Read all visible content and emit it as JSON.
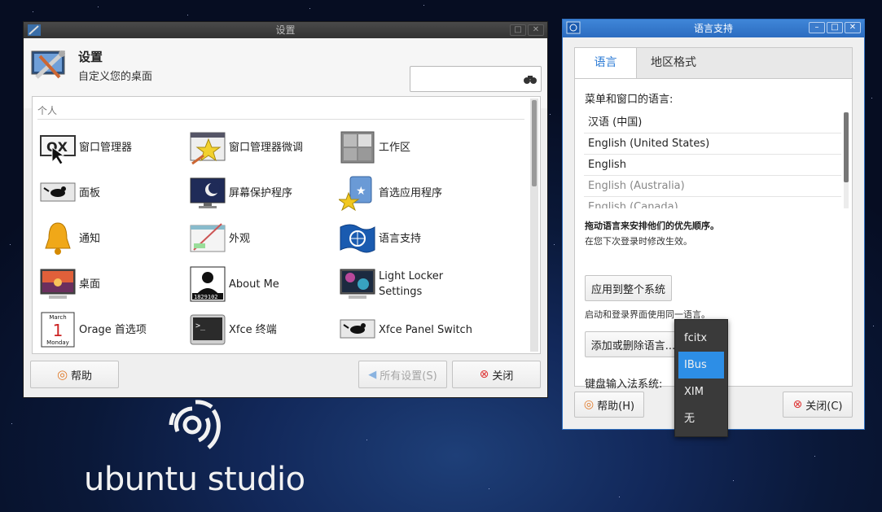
{
  "settings_window": {
    "title": "设置",
    "header_title": "设置",
    "header_subtitle": "自定义您的桌面",
    "search_value": "",
    "category": "个人",
    "items": [
      {
        "label": "窗口管理器",
        "icon": "window-manager-icon"
      },
      {
        "label": "窗口管理器微调",
        "icon": "window-manager-tweaks-icon"
      },
      {
        "label": "工作区",
        "icon": "workspaces-icon"
      },
      {
        "label": "面板",
        "icon": "panel-icon"
      },
      {
        "label": "屏幕保护程序",
        "icon": "screensaver-icon"
      },
      {
        "label": "首选应用程序",
        "icon": "preferred-applications-icon"
      },
      {
        "label": "通知",
        "icon": "notifications-bell-icon"
      },
      {
        "label": "外观",
        "icon": "appearance-icon"
      },
      {
        "label": "语言支持",
        "icon": "language-support-flag-icon"
      },
      {
        "label": "桌面",
        "icon": "desktop-icon"
      },
      {
        "label": "About Me",
        "icon": "about-me-icon",
        "badge": "1829102"
      },
      {
        "label": "Light Locker Settings",
        "icon": "light-locker-icon"
      },
      {
        "label": "Orage 首选项",
        "icon": "orage-calendar-icon",
        "cal_month": "March",
        "cal_day": "1",
        "cal_weekday": "Monday"
      },
      {
        "label": "Xfce 终端",
        "icon": "terminal-icon",
        "prompt": ">_"
      },
      {
        "label": "Xfce Panel Switch",
        "icon": "panel-switch-icon"
      }
    ],
    "help_button": "帮助",
    "all_settings_button": "所有设置(S)",
    "close_button": "关闭"
  },
  "language_window": {
    "title": "语言支持",
    "tabs": [
      {
        "label": "语言",
        "active": true
      },
      {
        "label": "地区格式",
        "active": false
      }
    ],
    "menu_language_label": "菜单和窗口的语言:",
    "languages": [
      {
        "label": "汉语 (中国)",
        "dim": false
      },
      {
        "label": "English (United States)",
        "dim": false
      },
      {
        "label": "English",
        "dim": false
      },
      {
        "label": "English (Australia)",
        "dim": true
      },
      {
        "label": "English (Canada)",
        "dim": true
      }
    ],
    "drag_hint": "拖动语言来安排他们的优先顺序。",
    "relogin_hint": "在您下次登录时修改生效。",
    "apply_system_button": "应用到整个系统",
    "login_hint": "启动和登录界面使用同一语言。",
    "add_remove_button": "添加或删除语言...",
    "keyboard_input_label": "键盘输入法系统:",
    "help_button": "帮助(H)",
    "close_button": "关闭(C)"
  },
  "input_method_menu": {
    "options": [
      "fcitx",
      "IBus",
      "XIM",
      "无"
    ],
    "selected": "IBus"
  },
  "desktop": {
    "logo_text": "ubuntu studio"
  },
  "colors": {
    "accent": "#2d8ee6",
    "tab_active_text": "#2a7ad5",
    "titlebar_dark": "#3a3a3a"
  }
}
